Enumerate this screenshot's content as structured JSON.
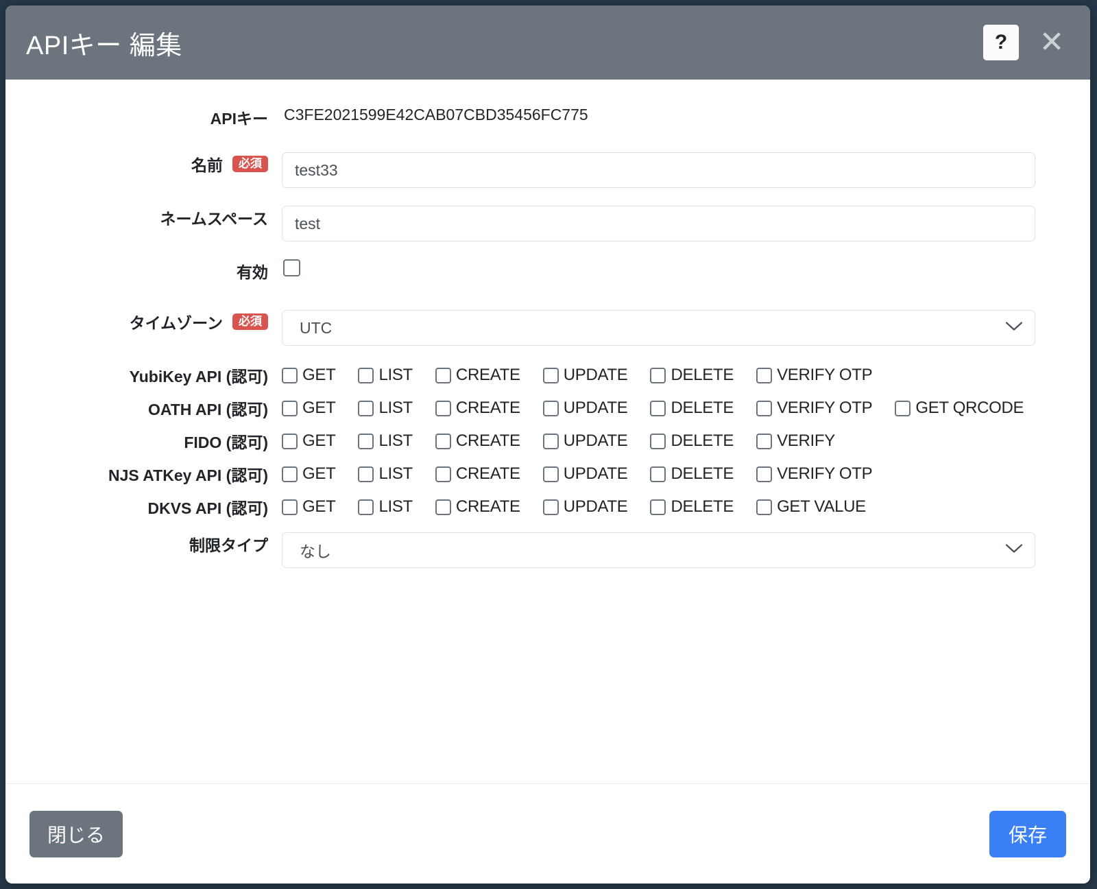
{
  "dialog": {
    "title": "APIキー 編集",
    "help_label": "?",
    "close_label": "✕"
  },
  "form": {
    "apikey": {
      "label": "APIキー",
      "value": "C3FE2021599E42CAB07CBD35456FC775"
    },
    "name": {
      "label": "名前",
      "required_badge": "必須",
      "value": "test33"
    },
    "namespace": {
      "label": "ネームスペース",
      "value": "test"
    },
    "enabled": {
      "label": "有効",
      "checked": false
    },
    "timezone": {
      "label": "タイムゾーン",
      "required_badge": "必須",
      "value": "UTC"
    },
    "limit_type": {
      "label": "制限タイプ",
      "value": "なし"
    }
  },
  "permissions": [
    {
      "label": "YubiKey API (認可)",
      "options": [
        {
          "label": "GET",
          "checked": false
        },
        {
          "label": "LIST",
          "checked": false
        },
        {
          "label": "CREATE",
          "checked": false
        },
        {
          "label": "UPDATE",
          "checked": false
        },
        {
          "label": "DELETE",
          "checked": false
        },
        {
          "label": "VERIFY OTP",
          "checked": false
        }
      ]
    },
    {
      "label": "OATH API (認可)",
      "options": [
        {
          "label": "GET",
          "checked": false
        },
        {
          "label": "LIST",
          "checked": false
        },
        {
          "label": "CREATE",
          "checked": false
        },
        {
          "label": "UPDATE",
          "checked": false
        },
        {
          "label": "DELETE",
          "checked": false
        },
        {
          "label": "VERIFY OTP",
          "checked": false
        },
        {
          "label": "GET QRCODE",
          "checked": false
        }
      ]
    },
    {
      "label": "FIDO (認可)",
      "options": [
        {
          "label": "GET",
          "checked": false
        },
        {
          "label": "LIST",
          "checked": false
        },
        {
          "label": "CREATE",
          "checked": false
        },
        {
          "label": "UPDATE",
          "checked": false
        },
        {
          "label": "DELETE",
          "checked": false
        },
        {
          "label": "VERIFY",
          "checked": false
        }
      ]
    },
    {
      "label": "NJS ATKey API (認可)",
      "options": [
        {
          "label": "GET",
          "checked": false
        },
        {
          "label": "LIST",
          "checked": false
        },
        {
          "label": "CREATE",
          "checked": false
        },
        {
          "label": "UPDATE",
          "checked": false
        },
        {
          "label": "DELETE",
          "checked": false
        },
        {
          "label": "VERIFY OTP",
          "checked": false
        }
      ]
    },
    {
      "label": "DKVS API (認可)",
      "options": [
        {
          "label": "GET",
          "checked": false
        },
        {
          "label": "LIST",
          "checked": false
        },
        {
          "label": "CREATE",
          "checked": false
        },
        {
          "label": "UPDATE",
          "checked": false
        },
        {
          "label": "DELETE",
          "checked": false
        },
        {
          "label": "GET VALUE",
          "checked": false
        }
      ]
    }
  ],
  "footer": {
    "close_label": "閉じる",
    "save_label": "保存"
  },
  "colors": {
    "header_bg": "#6c757d",
    "required_badge": "#d9534f",
    "save_button": "#3b7ff5",
    "close_button": "#6c757d",
    "input_border": "#dee2e6"
  }
}
